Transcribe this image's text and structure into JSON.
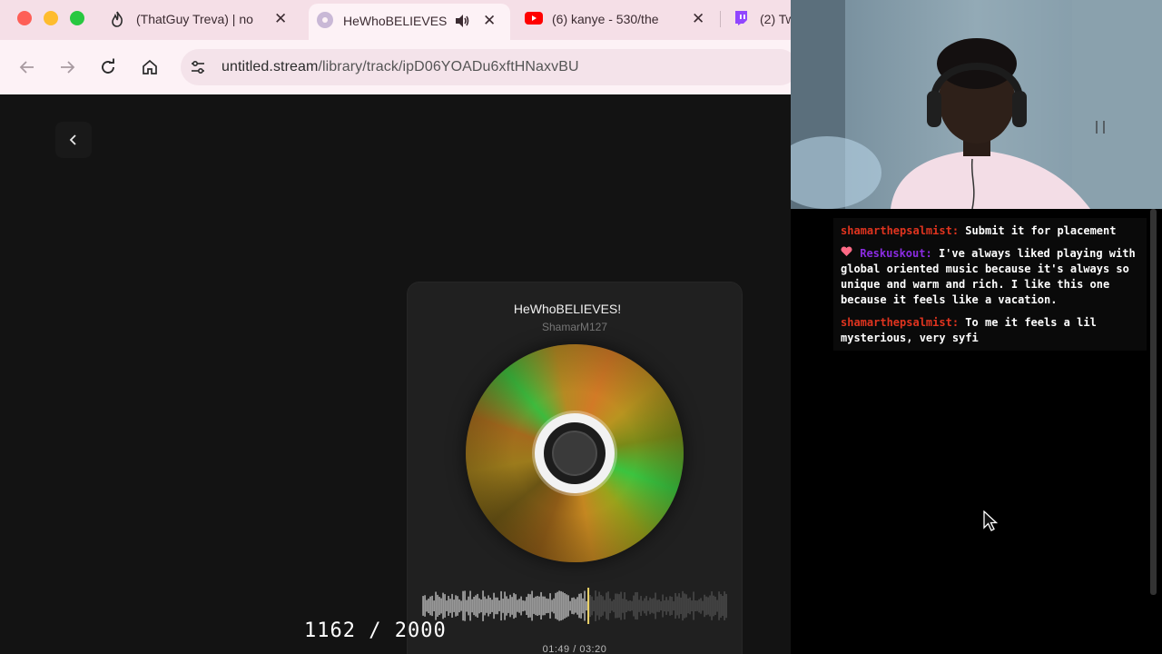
{
  "browser": {
    "tabs": [
      {
        "title": "(ThatGuy Treva) | no",
        "icon": "fire-icon"
      },
      {
        "title": "HeWhoBELIEVES!",
        "icon": "disc-icon",
        "active": true
      },
      {
        "title": "(6) kanye - 530/the",
        "icon": "youtube-icon"
      },
      {
        "title": "(2) Tw",
        "icon": "twitch-icon"
      }
    ],
    "url_host": "untitled.stream",
    "url_path": "/library/track/ipD06YOADu6xftHNaxvBU"
  },
  "player": {
    "title": "HeWhoBELIEVES!",
    "artist": "ShamarM127",
    "time_current": "01:49",
    "time_total": "03:20",
    "time_display": "01:49 / 03:20",
    "progress": 0.545
  },
  "overlay": {
    "counter": "1162 / 2000"
  },
  "chat": {
    "messages": [
      {
        "user": "shamarthepsalmist",
        "user_color": "#e0341f",
        "text": "Submit it for placement",
        "badge": false
      },
      {
        "user": "Reskuskout",
        "user_color": "#8a2be2",
        "text": "I've always liked playing with global oriented music because it's always so unique and warm and rich. I like this one because it feels like a vacation.",
        "badge": true
      },
      {
        "user": "shamarthepsalmist",
        "user_color": "#e0341f",
        "text": "To me it feels a lil mysterious, very syfi",
        "badge": false
      }
    ]
  },
  "colors": {
    "tab_bar": "#f5dfe7",
    "toolbar": "#fdf2f6",
    "page_bg": "#131313",
    "card_bg": "#202020",
    "playhead": "#f0d66a"
  }
}
